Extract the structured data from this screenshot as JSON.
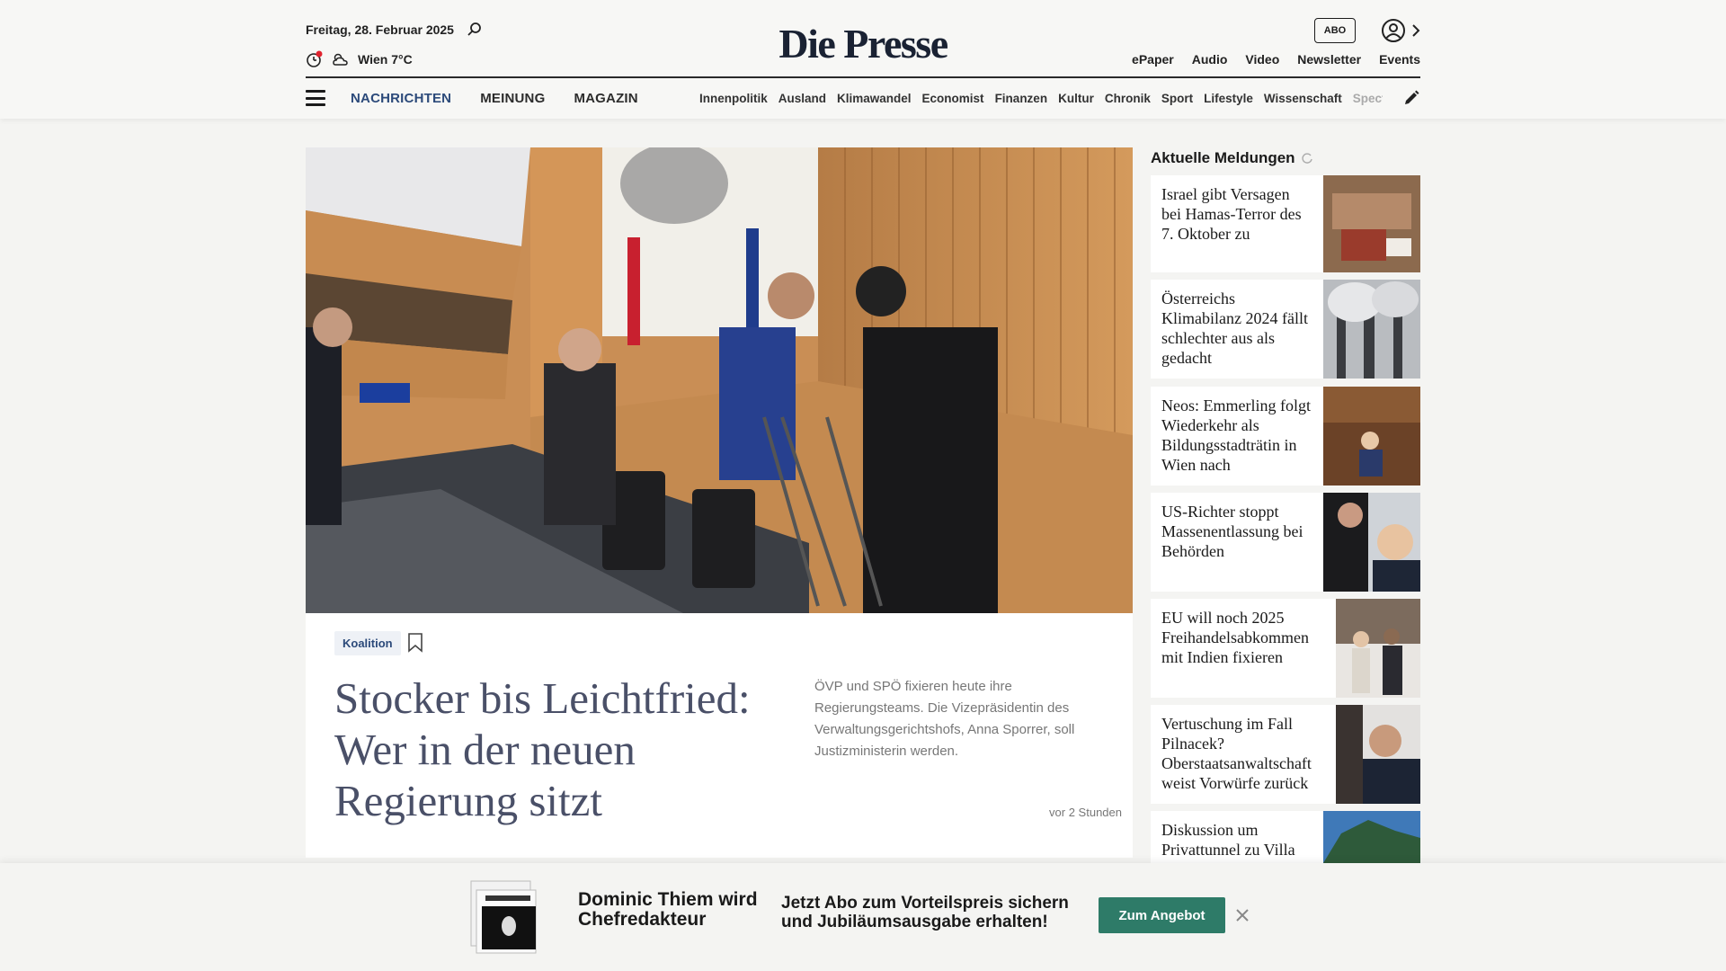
{
  "header": {
    "date": "Freitag, 28. Februar 2025",
    "weather": "Wien 7°C",
    "logo": "Die Presse",
    "abo_label": "ABO",
    "links": [
      "ePaper",
      "Audio",
      "Video",
      "Newsletter",
      "Events"
    ]
  },
  "nav": {
    "main": [
      "NACHRICHTEN",
      "MEINUNG",
      "MAGAZIN"
    ],
    "sections": [
      "Innenpolitik",
      "Ausland",
      "Klimawandel",
      "Economist",
      "Finanzen",
      "Kultur",
      "Chronik",
      "Sport",
      "Lifestyle",
      "Wissenschaft"
    ],
    "truncated_section": "Spectr"
  },
  "hero": {
    "tag": "Koalition",
    "headline": "Stocker bis Leichtfried: Wer in der neuen Regierung sitzt",
    "teaser": "ÖVP und SPÖ fixieren heute ihre Regierungsteams. Die Vizepräsidentin des Verwaltungsgerichtshofs, Anna Sporrer, soll Justizministerin werden.",
    "time": "vor 2 Stunden"
  },
  "sidebar": {
    "title": "Aktuelle Meldungen",
    "items": [
      {
        "title": "Israel gibt Versagen bei Hamas-Terror des 7. Oktober zu"
      },
      {
        "title": "Österreichs Klimabilanz 2024 fällt schlechter aus als gedacht"
      },
      {
        "title": "Neos: Emmerling folgt Wiederkehr als Bildungsstadträtin in Wien nach"
      },
      {
        "title": "US-Richter stoppt Massenentlassung bei Behörden"
      },
      {
        "title": "EU will noch 2025 Freihandelsabkommen mit Indien fixieren"
      },
      {
        "title": "Vertuschung im Fall Pilnacek? Oberstaatsanwaltschaft weist Vorwürfe zurück"
      },
      {
        "title": "Diskussion um Privattunnel zu Villa"
      }
    ]
  },
  "promo": {
    "title": "Dominic Thiem wird Chefredakteur",
    "text": "Jetzt Abo zum Vorteilspreis sichern und Jubiläumsausgabe erhalten!",
    "button": "Zum Angebot"
  },
  "colors": {
    "accent_blue": "#2c4a7a",
    "promo_green": "#2e7b68",
    "headline_gray": "#4a5068"
  }
}
